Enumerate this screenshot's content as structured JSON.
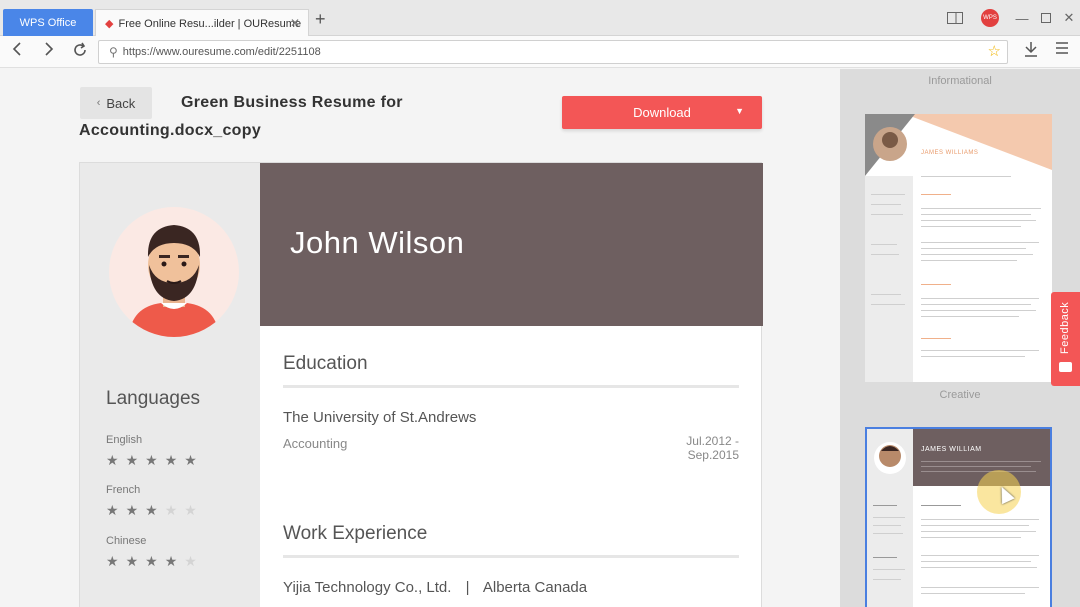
{
  "browser": {
    "tabs": [
      {
        "label": "WPS Office"
      },
      {
        "label": "Free Online Resu...ilder | OUResume"
      }
    ],
    "url": "https://www.ouresume.com/edit/2251108",
    "avatar_initials": "WPS"
  },
  "editor": {
    "back_label": "Back",
    "doc_title": "Green Business Resume for Accounting.docx_copy",
    "download_label": "Download",
    "accent_color": "#f35656"
  },
  "resume": {
    "name": "John Wilson",
    "languages_heading": "Languages",
    "languages": [
      {
        "name": "English",
        "rating": 5
      },
      {
        "name": "French",
        "rating": 3
      },
      {
        "name": "Chinese",
        "rating": 4
      }
    ],
    "education": {
      "heading": "Education",
      "school": "The University of St.Andrews",
      "major": "Accounting",
      "date": "Jul.2012 - Sep.2015"
    },
    "work": {
      "heading": "Work Experience",
      "company": "Yijia Technology Co., Ltd.",
      "location": "Alberta Canada",
      "separator": "|"
    },
    "header_color": "#6e5f60"
  },
  "templates": {
    "categories": [
      {
        "label": "Informational"
      },
      {
        "label": "Creative"
      }
    ],
    "thumbs": [
      {
        "name": "JAMES WILLIAMS"
      },
      {
        "name": "JAMES WILLIAM"
      }
    ],
    "selected_border": "#4a7fe0"
  },
  "feedback_label": "Feedback"
}
